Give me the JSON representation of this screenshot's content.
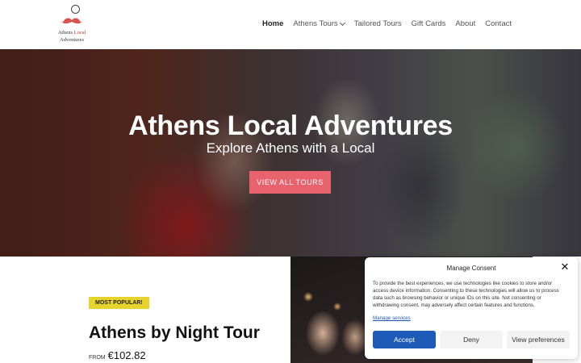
{
  "logo": {
    "line1_a": "Athens",
    "line1_b": "Local",
    "line2": "Adventures"
  },
  "nav": {
    "items": [
      {
        "label": "Home"
      },
      {
        "label": "Athens Tours"
      },
      {
        "label": "Tailored Tours"
      },
      {
        "label": "Gift Cards"
      },
      {
        "label": "About"
      },
      {
        "label": "Contact"
      }
    ]
  },
  "hero": {
    "title": "Athens Local Adventures",
    "subtitle": "Explore Athens with a Local",
    "cta": "VIEW ALL TOURS"
  },
  "tour": {
    "badge": "MOST POPULAR!",
    "title": "Athens by Night Tour",
    "price_prefix": "FROM",
    "price": "€102.82"
  },
  "consent": {
    "title": "Manage Consent",
    "close": "✕",
    "text": "To provide the best experiences, we use technologies like cookies to store and/or access device information. Consenting to these technologies will allow us to process data such as browsing behavior or unique IDs on this site. Not consenting or withdrawing consent, may adversely affect certain features and functions.",
    "link": "Manage services",
    "accept": "Accept",
    "deny": "Deny",
    "preferences": "View preferences"
  },
  "colors": {
    "accent": "#e8636e",
    "badge": "#e7d32e",
    "consent_primary": "#1e5bb8"
  },
  "icons": {
    "logo": "monocle-mustache-logo",
    "dropdown": "chevron-down-icon",
    "close": "close-icon"
  }
}
